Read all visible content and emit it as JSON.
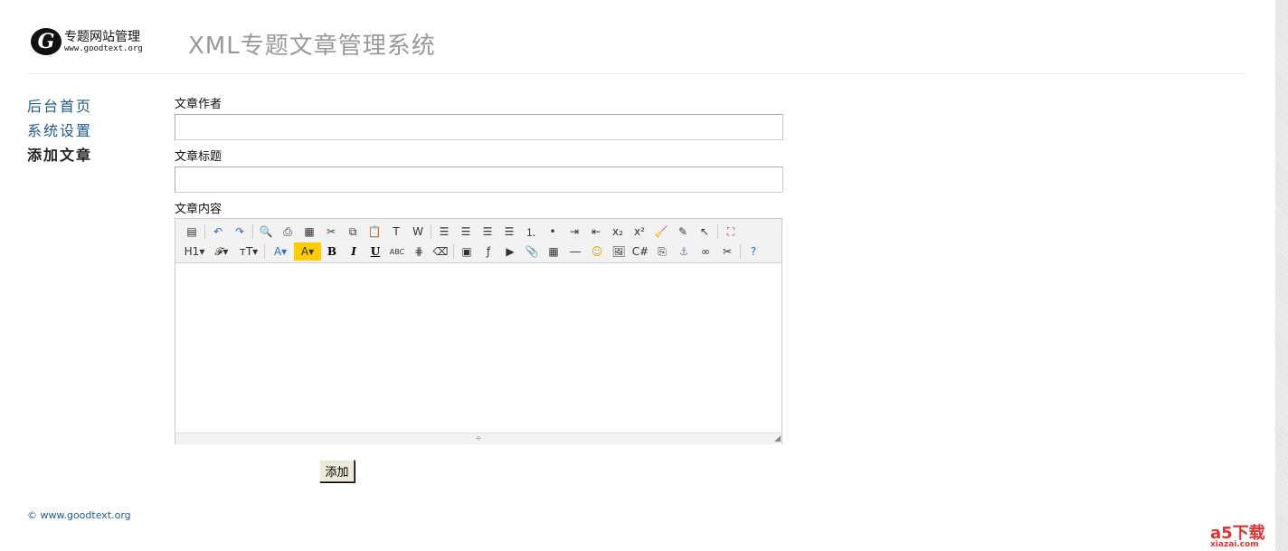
{
  "header": {
    "logo_text": "专题网站管理",
    "logo_url": "www.goodtext.org",
    "title": "XML专题文章管理系统"
  },
  "sidebar": {
    "items": [
      {
        "label": "后台首页"
      },
      {
        "label": "系统设置"
      },
      {
        "label": "添加文章"
      }
    ]
  },
  "form": {
    "author_label": "文章作者",
    "author_value": "",
    "title_label": "文章标题",
    "title_value": "",
    "content_label": "文章内容",
    "submit_label": "添加"
  },
  "toolbar": {
    "row1": [
      [
        "source",
        "▤"
      ],
      "|",
      [
        "undo",
        "↶"
      ],
      [
        "redo",
        "↷"
      ],
      "|",
      [
        "preview",
        "🔍"
      ],
      [
        "print",
        "⎙"
      ],
      [
        "select-all",
        "▦"
      ],
      [
        "cut",
        "✂"
      ],
      [
        "copy",
        "⧉"
      ],
      [
        "paste",
        "📋"
      ],
      [
        "paste-text",
        "T"
      ],
      [
        "paste-word",
        "W"
      ],
      "|",
      [
        "align-left",
        "☰"
      ],
      [
        "align-center",
        "☰"
      ],
      [
        "align-right",
        "☰"
      ],
      [
        "justify",
        "☰"
      ],
      [
        "ordered-list",
        "⒈"
      ],
      [
        "unordered-list",
        "•"
      ],
      [
        "indent",
        "⇥"
      ],
      [
        "outdent",
        "⇤"
      ],
      [
        "subscript",
        "x₂"
      ],
      [
        "superscript",
        "x²"
      ],
      [
        "clear-format",
        "🧹"
      ],
      [
        "select-all-text",
        "✎"
      ],
      [
        "select",
        "↖"
      ],
      "|",
      [
        "fullscreen",
        "⛶"
      ]
    ],
    "row2": [
      [
        "heading",
        "H1▾"
      ],
      [
        "font-family",
        "𝓕▾"
      ],
      [
        "font-size",
        "тT▾"
      ],
      "|",
      [
        "font-color",
        "A▾"
      ],
      [
        "highlight",
        "A▾"
      ],
      [
        "bold",
        "B"
      ],
      [
        "italic",
        "I"
      ],
      [
        "underline",
        "U"
      ],
      [
        "strikethrough",
        "ABC"
      ],
      [
        "line-height",
        "⋕"
      ],
      [
        "remove-format",
        "⌫"
      ],
      "|",
      [
        "insert-image",
        "▣"
      ],
      [
        "flash",
        "ƒ"
      ],
      [
        "media",
        "▶"
      ],
      [
        "attachment",
        "📎"
      ],
      [
        "table",
        "▦"
      ],
      [
        "hr",
        "―"
      ],
      [
        "emoticon",
        "☺"
      ],
      [
        "image-map",
        "🖼"
      ],
      [
        "code",
        "C#"
      ],
      [
        "page-break",
        "⎘"
      ],
      [
        "anchor",
        "⚓"
      ],
      [
        "link",
        "∞"
      ],
      [
        "unlink",
        "✂"
      ],
      "|",
      [
        "help",
        "?"
      ]
    ]
  },
  "editor": {
    "resize_glyph": "÷",
    "grip_glyph": "◢"
  },
  "footer": {
    "copyright": "© www.goodtext.org"
  },
  "watermark": {
    "text": "a5下载",
    "sub": "xiazai.com"
  }
}
